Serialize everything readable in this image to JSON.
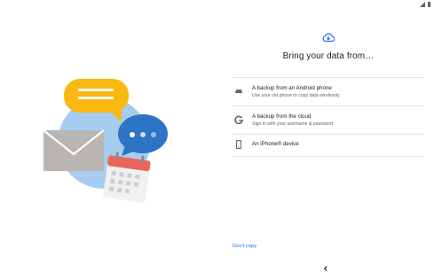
{
  "header": {
    "title": "Bring your data from…",
    "cloud_icon": "cloud-download-icon"
  },
  "options": [
    {
      "icon": "android-icon",
      "title": "A backup from an Android phone",
      "subtitle": "Use your old phone to copy data wirelessly"
    },
    {
      "icon": "google-g-icon",
      "title": "A backup from the cloud",
      "subtitle": "Sign in with your username & password"
    },
    {
      "icon": "phone-icon",
      "title": "An iPhone® device",
      "subtitle": ""
    }
  ],
  "footer": {
    "dont_copy": "Don't copy"
  },
  "navigation": {
    "back_icon": "back-chevron-icon"
  },
  "colors": {
    "accent": "#1a73e8",
    "illustration_circle": "#a6cdef",
    "bubble_yellow": "#f9b80f",
    "bubble_blue": "#2d73c6",
    "envelope": "#b9b5b2",
    "calendar_header": "#e8675a"
  }
}
